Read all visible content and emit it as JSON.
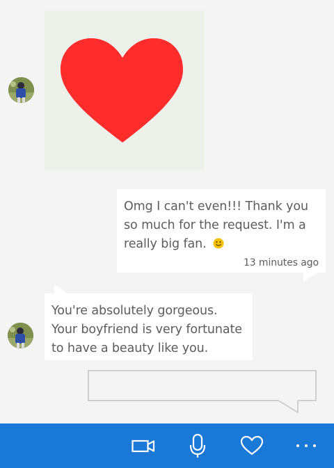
{
  "conversation": {
    "messages": [
      {
        "sender": "contact",
        "type": "image",
        "image_icon": "red-heart"
      },
      {
        "sender": "me",
        "text": "Omg I can't even!!! Thank you so much for the request. I'm a really big fan.",
        "emoji": "smiley",
        "timestamp": "13 minutes ago"
      },
      {
        "sender": "contact",
        "text": "You're absolutely gorgeous. Your boyfriend is very fortunate to have a beauty like you."
      }
    ]
  },
  "composer": {
    "value": "",
    "placeholder": ""
  },
  "app_bar": {
    "buttons": [
      {
        "icon": "video-icon"
      },
      {
        "icon": "microphone-icon"
      },
      {
        "icon": "heart-icon"
      },
      {
        "icon": "more-icon"
      }
    ]
  },
  "colors": {
    "background": "#f4f4f4",
    "bubble": "#ffffff",
    "text": "#5c5c5c",
    "heart": "#ff2c2c",
    "app_bar": "#1a78d6",
    "emoji": "#f2c200"
  }
}
